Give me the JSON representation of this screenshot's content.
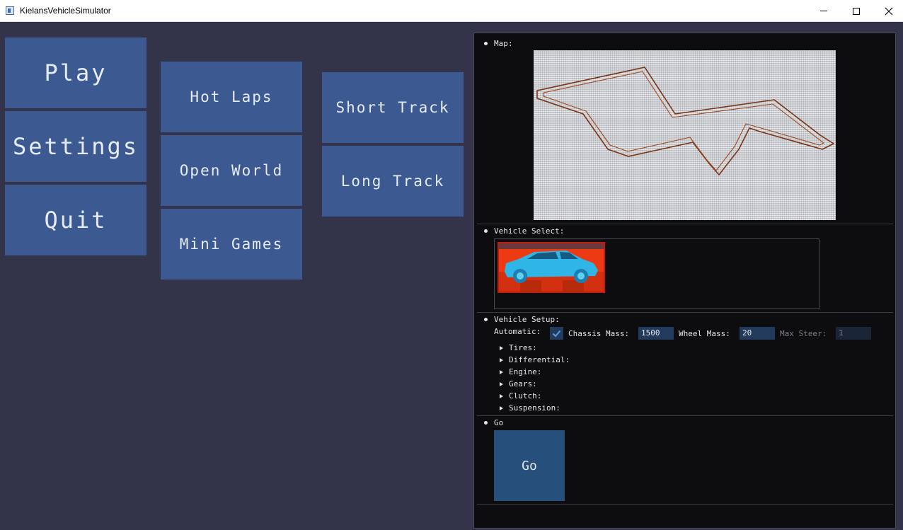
{
  "window": {
    "title": "KielansVehicleSimulator",
    "icon": "app-window-icon"
  },
  "main_menu": {
    "column1": [
      "Play",
      "Settings",
      "Quit"
    ],
    "column2": [
      "Hot Laps",
      "Open World",
      "Mini Games"
    ],
    "column3": [
      "Short Track",
      "Long Track"
    ]
  },
  "panel": {
    "map": {
      "header": "Map:"
    },
    "vehicle_select": {
      "header": "Vehicle Select:"
    },
    "vehicle_setup": {
      "header": "Vehicle Setup:",
      "automatic_label": "Automatic:",
      "automatic_checked": true,
      "chassis_mass_label": "Chassis Mass:",
      "chassis_mass_value": "1500",
      "wheel_mass_label": "Wheel Mass:",
      "wheel_mass_value": "20",
      "max_steer_label": "Max Steer:",
      "max_steer_value": "1",
      "sections": [
        "Tires:",
        "Differential:",
        "Engine:",
        "Gears:",
        "Clutch:",
        "Suspension:"
      ]
    },
    "go": {
      "header": "Go",
      "button_label": "Go"
    }
  },
  "colors": {
    "background": "#33334a",
    "menu_button": "#3c5a91",
    "panel_bg": "#0d0d0f",
    "input_bg": "#223a5c",
    "go_button": "#274f7b"
  }
}
